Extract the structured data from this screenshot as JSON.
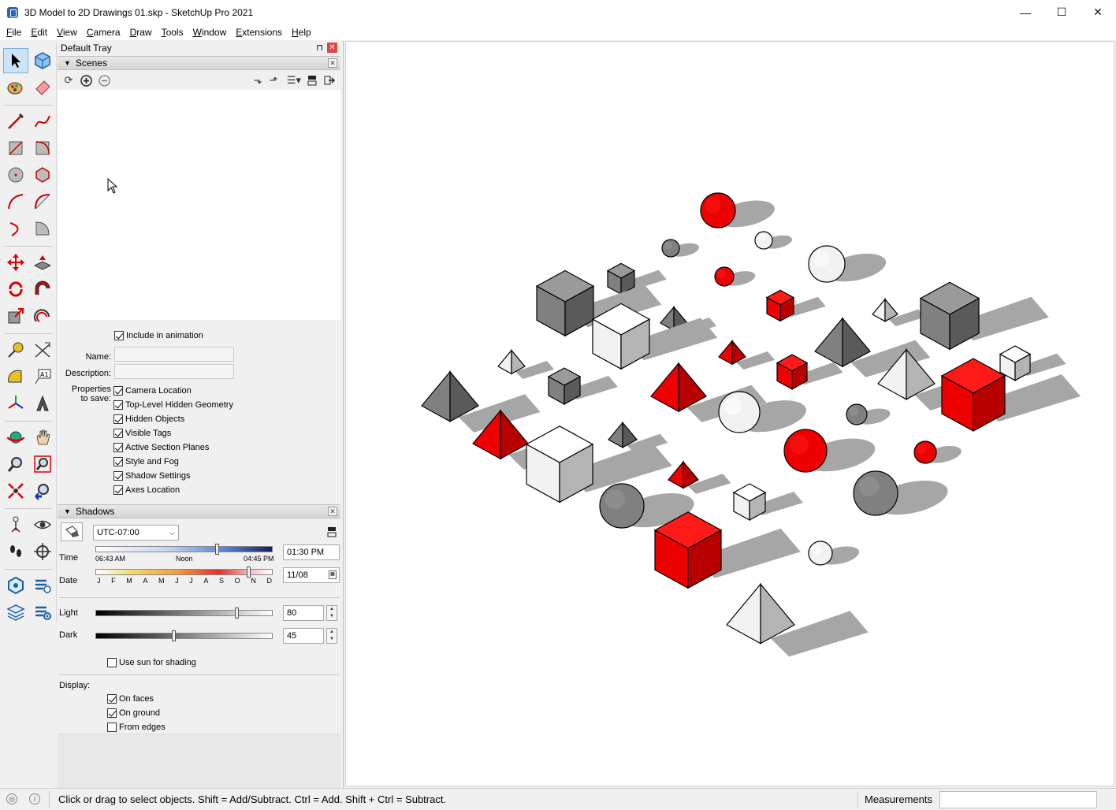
{
  "window": {
    "title": "3D Model to 2D Drawings 01.skp - SketchUp Pro 2021",
    "minimize": "—",
    "maximize": "☐",
    "close": "✕"
  },
  "menu": [
    {
      "u": "F",
      "rest": "ile"
    },
    {
      "u": "E",
      "rest": "dit"
    },
    {
      "u": "V",
      "rest": "iew"
    },
    {
      "u": "C",
      "rest": "amera"
    },
    {
      "u": "D",
      "rest": "raw"
    },
    {
      "u": "T",
      "rest": "ools"
    },
    {
      "u": "W",
      "rest": "indow"
    },
    {
      "u": "E",
      "rest": "xtensions"
    },
    {
      "u": "H",
      "rest": "elp"
    }
  ],
  "tray": {
    "title": "Default Tray",
    "pin": "📌",
    "close": "✕",
    "scenes": {
      "header": "Scenes",
      "include_in_animation": "Include in animation",
      "name_label": "Name:",
      "description_label": "Description:",
      "properties_label_1": "Properties",
      "properties_label_2": "to save:",
      "properties": [
        {
          "label": "Camera Location",
          "checked": true
        },
        {
          "label": "Top-Level Hidden Geometry",
          "checked": true
        },
        {
          "label": "Hidden Objects",
          "checked": true
        },
        {
          "label": "Visible Tags",
          "checked": true
        },
        {
          "label": "Active Section Planes",
          "checked": true
        },
        {
          "label": "Style and Fog",
          "checked": true
        },
        {
          "label": "Shadow Settings",
          "checked": true
        },
        {
          "label": "Axes Location",
          "checked": true
        }
      ]
    },
    "shadows": {
      "header": "Shadows",
      "timezone": "UTC-07:00",
      "time_label": "Time",
      "time_start": "06:43 AM",
      "time_noon": "Noon",
      "time_end": "04:45 PM",
      "time_value": "01:30 PM",
      "date_label": "Date",
      "months": [
        "J",
        "F",
        "M",
        "A",
        "M",
        "J",
        "J",
        "A",
        "S",
        "O",
        "N",
        "D"
      ],
      "date_value": "11/08",
      "light_label": "Light",
      "light_value": "80",
      "dark_label": "Dark",
      "dark_value": "45",
      "use_sun": "Use sun for shading",
      "display_label": "Display:",
      "on_faces": "On faces",
      "on_ground": "On ground",
      "from_edges": "From edges"
    }
  },
  "status": {
    "message": "Click or drag to select objects. Shift = Add/Subtract. Ctrl = Add. Shift + Ctrl = Subtract.",
    "measurements_label": "Measurements"
  },
  "colors": {
    "red": "#ee0000",
    "gray": "#808080",
    "white": "#ffffff",
    "shadow": "#a6a6a6"
  }
}
